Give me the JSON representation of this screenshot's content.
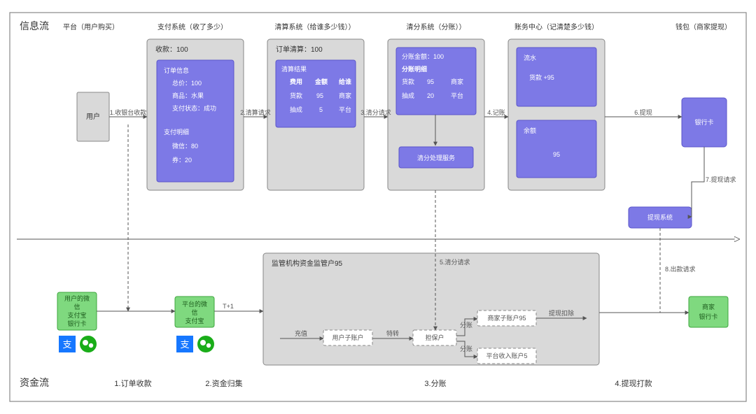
{
  "lanes": {
    "info": "信息流",
    "fund": "资金流"
  },
  "cols": {
    "platform": "平台（用户购买）",
    "pay": "支付系统（收了多少）",
    "clear": "清算系统（给谁多少钱））",
    "split": "清分系统（分账））",
    "ledger": "账务中心（记清楚多少钱）",
    "wallet": "钱包（商家提现）"
  },
  "platform": {
    "user": "用户"
  },
  "pay": {
    "title": "收款：100",
    "order": "订单信息",
    "total": "总价：100",
    "goods": "商品：水果",
    "status": "支付状态：成功",
    "detail": "支付明细",
    "wechat": "微信：80",
    "coupon": "券：20"
  },
  "clear": {
    "title": "订单清算：100",
    "result": "清算结果",
    "h1": "费用",
    "h2": "金额",
    "h3": "给谁",
    "r1a": "货款",
    "r1b": "95",
    "r1c": "商家",
    "r2a": "抽成",
    "r2b": "5",
    "r2c": "平台"
  },
  "split": {
    "title": "分账金额：100",
    "detail": "分账明细",
    "r1a": "货款",
    "r1b": "95",
    "r1c": "商家",
    "r2a": "抽成",
    "r2b": "20",
    "r2c": "平台",
    "svc": "清分处理服务"
  },
  "ledger": {
    "flow": "流水",
    "flowline": "货款   +95",
    "bal": "余额",
    "balv": "95"
  },
  "wallet": {
    "card": "银行卡",
    "withdraw": "提现系统"
  },
  "edges": {
    "e1": "1.收银台收款",
    "e2": "2.清算请求",
    "e3": "3.清分请求",
    "e4": "4.记账",
    "e5": "5.清分请求",
    "e6": "6.提现",
    "e7": "7.提现请求",
    "e8": "8.出款请求"
  },
  "fund": {
    "usercard": {
      "l1": "用户的微",
      "l2": "信",
      "l3": "支付宝",
      "l4": "银行卡"
    },
    "platcard": {
      "l1": "平台的微",
      "l2": "信",
      "l3": "支付宝"
    },
    "reg": "监管机构资金监管户95",
    "sub_user": "用户子账户",
    "sub_guar": "担保户",
    "sub_merch": "商家子账户95",
    "sub_plat": "平台收入账户5",
    "merchbank": {
      "l1": "商家",
      "l2": "银行卡"
    },
    "edge_tplus": "T+1",
    "edge_charge": "充值",
    "edge_trans": "特转",
    "edge_split1": "分账",
    "edge_split2": "分账",
    "edge_deduct": "提现扣除",
    "f1": "1.订单收款",
    "f2": "2.资金归集",
    "f3": "3.分账",
    "f4": "4.提现打款"
  }
}
